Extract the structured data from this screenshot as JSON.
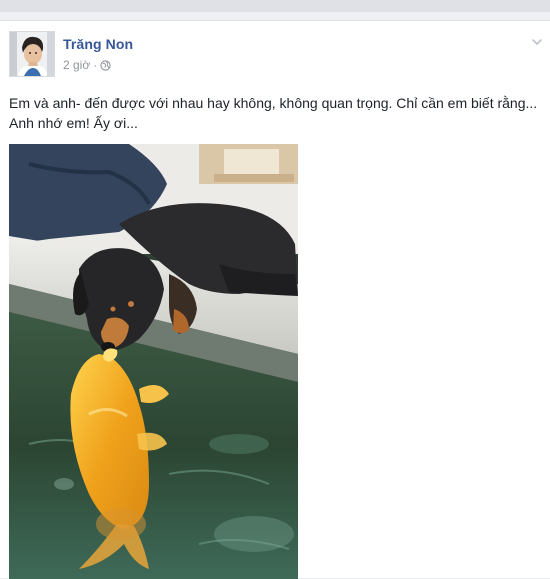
{
  "post": {
    "author": "Trăng Non",
    "timestamp": "2 giờ",
    "separator": "·",
    "privacy_icon": "globe-icon",
    "menu_icon": "chevron-down-icon",
    "text": "Em và anh- đến được với nhau hay không, không quan trọng. Chỉ cần em biết rằng... Anh nhớ em! Ấy ơi...",
    "photo_icon": "puppy-kissing-koi-photo"
  },
  "colors": {
    "author_link": "#365899",
    "meta_text": "#90949c",
    "body_text": "#1d2129",
    "koi_orange": "#f0a21c"
  }
}
